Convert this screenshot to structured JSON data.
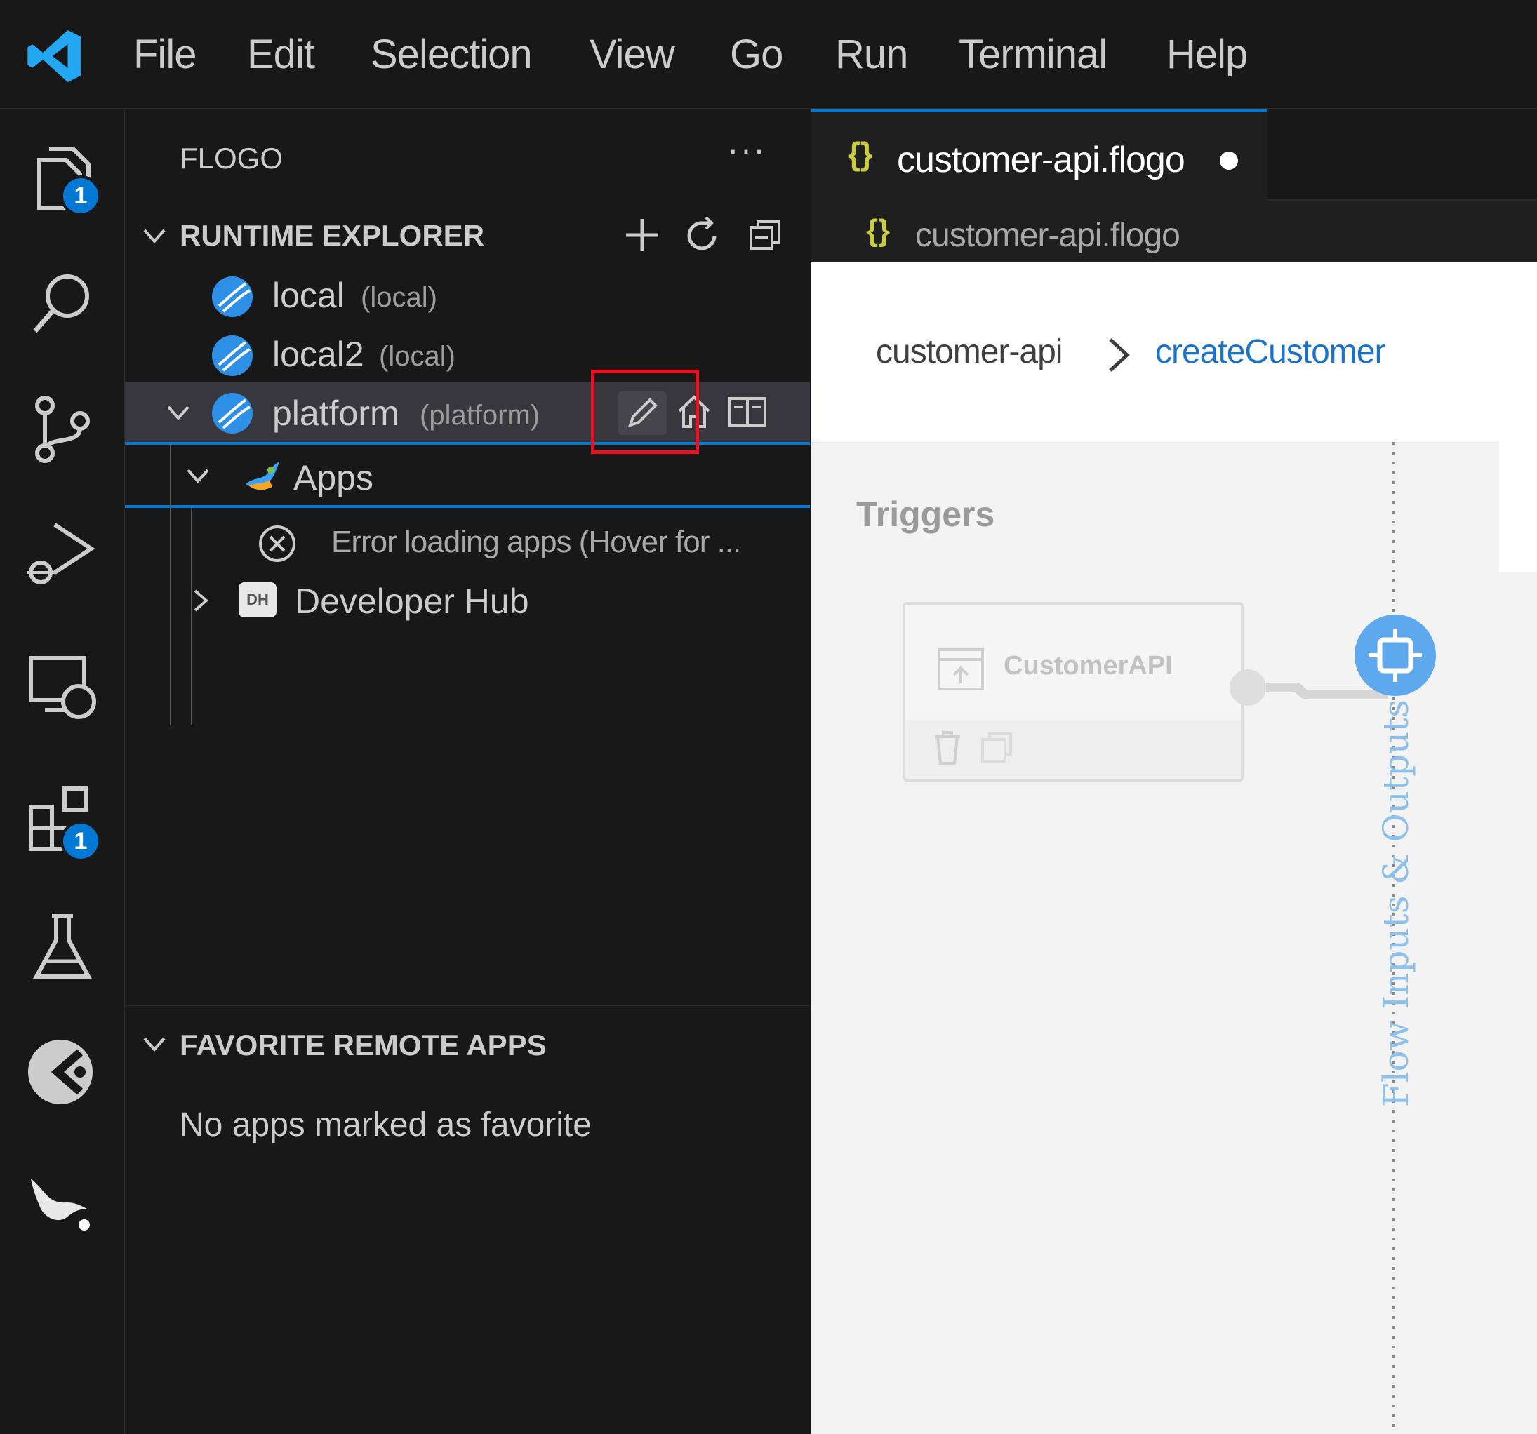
{
  "menubar": {
    "items": [
      "File",
      "Edit",
      "Selection",
      "View",
      "Go",
      "Run",
      "Terminal",
      "Help"
    ]
  },
  "activity_bar": {
    "explorer_badge": "1",
    "extensions_badge": "1"
  },
  "sidebar": {
    "title": "FLOGO",
    "more_label": "···",
    "runtime_explorer": {
      "header": "RUNTIME EXPLORER",
      "runtimes": [
        {
          "label": "local",
          "description": "(local)"
        },
        {
          "label": "local2",
          "description": "(local)"
        },
        {
          "label": "platform",
          "description": "(platform)"
        }
      ],
      "apps_label": "Apps",
      "error_text": "Error loading apps (Hover for ...",
      "developer_hub_label": "Developer Hub",
      "developer_hub_icon_text": "DH"
    },
    "favorites": {
      "header": "FAVORITE REMOTE APPS",
      "empty_text": "No apps marked as favorite"
    }
  },
  "editor": {
    "tab_label": "customer-api.flogo",
    "tab_brace": "{}",
    "breadcrumb_file": "customer-api.flogo",
    "flow": {
      "app_name": "customer-api",
      "separator": ">",
      "flow_name": "createCustomer",
      "triggers_label": "Triggers",
      "trigger_name": "CustomerAPI",
      "side_label": "Flow Inputs & Outputs"
    }
  },
  "colors": {
    "accent": "#0078d4",
    "highlight_box": "#e81123",
    "flow_link": "#1a73c8",
    "json_brace": "#cbcb41",
    "handle_blue": "#5ea8ee"
  }
}
